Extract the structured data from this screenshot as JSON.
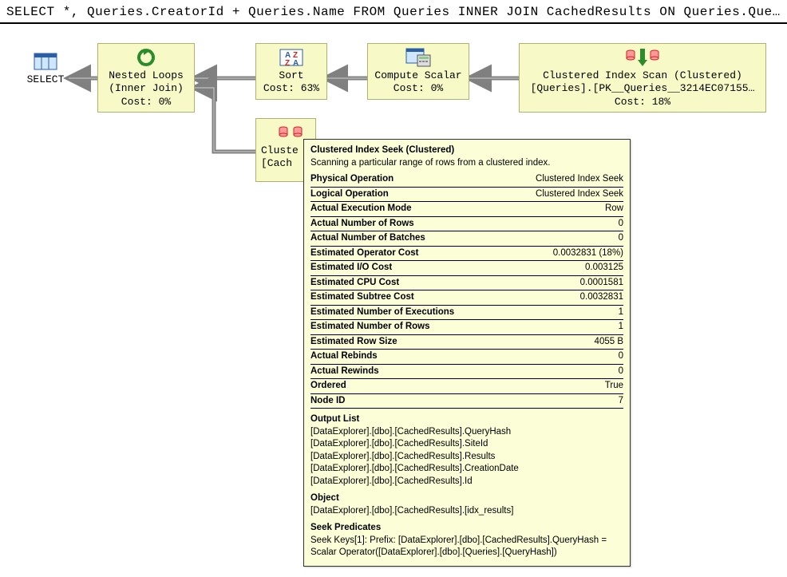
{
  "sql": "SELECT *, Queries.CreatorId + Queries.Name FROM Queries INNER JOIN CachedResults ON Queries.QueryH…",
  "nodes": {
    "select": {
      "title": "SELECT"
    },
    "nested": {
      "l1": "Nested Loops",
      "l2": "(Inner Join)",
      "cost": "Cost: 0%"
    },
    "sort": {
      "l1": "Sort",
      "cost": "Cost: 63%"
    },
    "compute": {
      "l1": "Compute Scalar",
      "cost": "Cost: 0%"
    },
    "scan": {
      "l1": "Clustered Index Scan (Clustered)",
      "l2": "[Queries].[PK__Queries__3214EC07155…",
      "cost": "Cost: 18%"
    },
    "seek": {
      "l1": "Cluste",
      "l2": "[Cach"
    }
  },
  "tooltip": {
    "title": "Clustered Index Seek (Clustered)",
    "desc": "Scanning a particular range of rows from a clustered index.",
    "rows": [
      {
        "k": "Physical Operation",
        "v": "Clustered Index Seek"
      },
      {
        "k": "Logical Operation",
        "v": "Clustered Index Seek"
      },
      {
        "k": "Actual Execution Mode",
        "v": "Row"
      },
      {
        "k": "Actual Number of Rows",
        "v": "0"
      },
      {
        "k": "Actual Number of Batches",
        "v": "0"
      },
      {
        "k": "Estimated Operator Cost",
        "v": "0.0032831 (18%)"
      },
      {
        "k": "Estimated I/O Cost",
        "v": "0.003125"
      },
      {
        "k": "Estimated CPU Cost",
        "v": "0.0001581"
      },
      {
        "k": "Estimated Subtree Cost",
        "v": "0.0032831"
      },
      {
        "k": "Estimated Number of Executions",
        "v": "1"
      },
      {
        "k": "Estimated Number of Rows",
        "v": "1"
      },
      {
        "k": "Estimated Row Size",
        "v": "4055 B"
      },
      {
        "k": "Actual Rebinds",
        "v": "0"
      },
      {
        "k": "Actual Rewinds",
        "v": "0"
      },
      {
        "k": "Ordered",
        "v": "True"
      },
      {
        "k": "Node ID",
        "v": "7"
      }
    ],
    "sections": [
      {
        "head": "Output List",
        "body": "[DataExplorer].[dbo].[CachedResults].QueryHash\n[DataExplorer].[dbo].[CachedResults].SiteId\n[DataExplorer].[dbo].[CachedResults].Results\n[DataExplorer].[dbo].[CachedResults].CreationDate\n[DataExplorer].[dbo].[CachedResults].Id"
      },
      {
        "head": "Object",
        "body": "[DataExplorer].[dbo].[CachedResults].[idx_results]"
      },
      {
        "head": "Seek Predicates",
        "body": "Seek Keys[1]: Prefix: [DataExplorer].[dbo].[CachedResults].QueryHash = Scalar Operator([DataExplorer].[dbo].[Queries].[QueryHash])"
      }
    ]
  }
}
